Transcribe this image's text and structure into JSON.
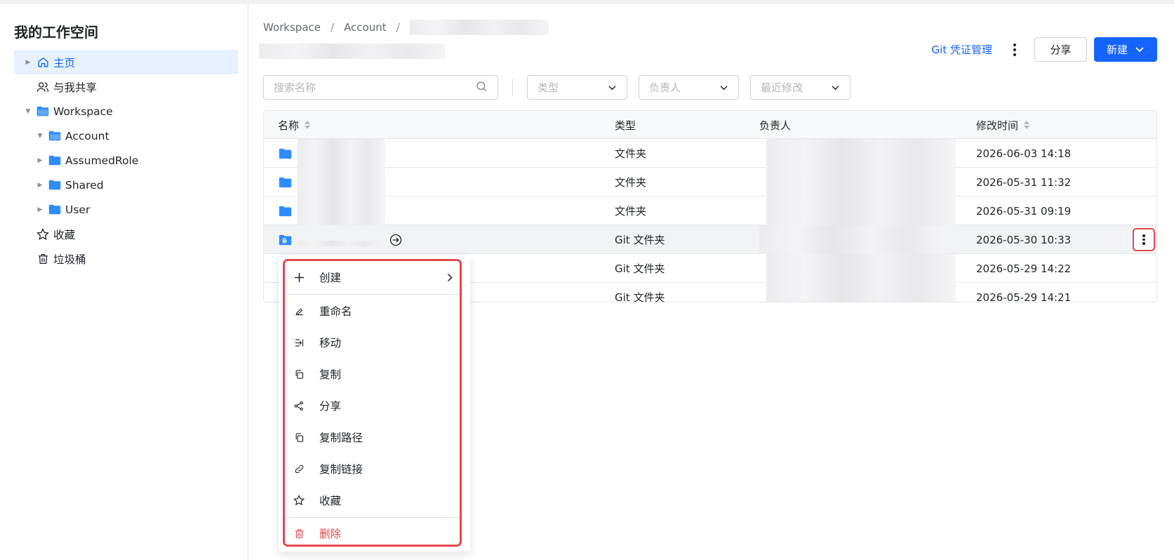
{
  "sidebar": {
    "title": "我的工作空间",
    "items": [
      {
        "label": "主页",
        "icon": "home-icon"
      },
      {
        "label": "与我共享",
        "icon": "users-icon"
      },
      {
        "label": "Workspace",
        "icon": "folder-open-icon"
      },
      {
        "label": "Account",
        "icon": "folder-open-icon"
      },
      {
        "label": "AssumedRole",
        "icon": "folder-icon"
      },
      {
        "label": "Shared",
        "icon": "folder-icon"
      },
      {
        "label": "User",
        "icon": "folder-icon"
      },
      {
        "label": "收藏",
        "icon": "star-icon"
      },
      {
        "label": "垃圾桶",
        "icon": "trash-icon"
      }
    ]
  },
  "breadcrumb": [
    "Workspace",
    "Account"
  ],
  "header": {
    "git_link": "Git 凭证管理",
    "share": "分享",
    "new": "新建"
  },
  "filters": {
    "search_placeholder": "搜索名称",
    "type": "类型",
    "owner": "负责人",
    "modified": "最近修改"
  },
  "table": {
    "columns": [
      "名称",
      "类型",
      "负责人",
      "修改时间"
    ],
    "rows": [
      {
        "type": "文件夹",
        "modified": "2026-06-03 14:18"
      },
      {
        "type": "文件夹",
        "modified": "2026-05-31 11:32"
      },
      {
        "type": "文件夹",
        "modified": "2026-05-31 09:19"
      },
      {
        "type": "Git 文件夹",
        "modified": "2026-05-30 10:33"
      },
      {
        "type": "Git 文件夹",
        "modified": "2026-05-29 14:22"
      },
      {
        "type": "Git 文件夹",
        "modified": "2026-05-29 14:21"
      }
    ]
  },
  "menu": {
    "items": [
      {
        "label": "创建",
        "icon": "plus-icon"
      },
      {
        "label": "重命名",
        "icon": "edit-icon"
      },
      {
        "label": "移动",
        "icon": "move-icon"
      },
      {
        "label": "复制",
        "icon": "copy-icon"
      },
      {
        "label": "分享",
        "icon": "share-icon"
      },
      {
        "label": "复制路径",
        "icon": "copy-icon"
      },
      {
        "label": "复制链接",
        "icon": "link-icon"
      },
      {
        "label": "收藏",
        "icon": "star-icon"
      },
      {
        "label": "删除",
        "icon": "trash-icon"
      }
    ]
  },
  "colors": {
    "accent": "#1664ff",
    "danger": "#e5484d",
    "folder": "#2f8cff"
  }
}
